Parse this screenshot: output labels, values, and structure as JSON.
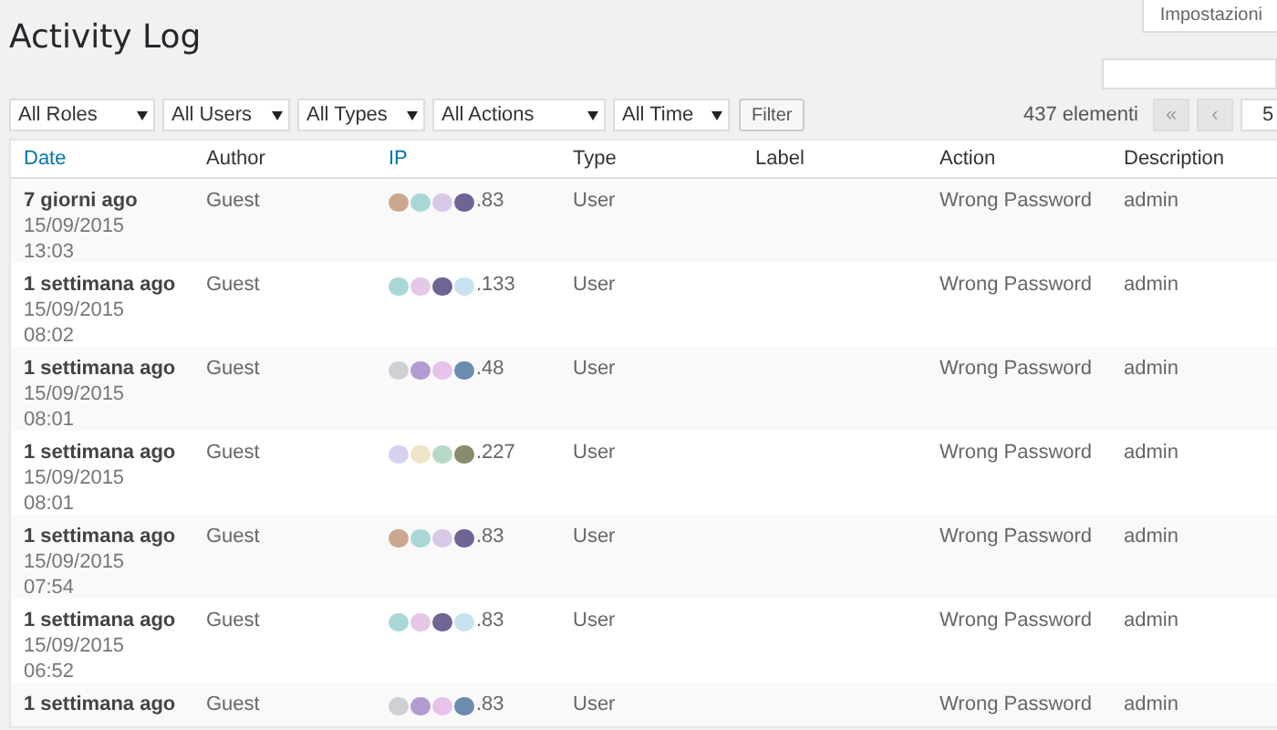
{
  "screen_options_tab": "Impostazioni",
  "title": "Activity Log",
  "filters": [
    {
      "label": "All Roles"
    },
    {
      "label": "All Users"
    },
    {
      "label": "All Types"
    },
    {
      "label": "All Actions"
    },
    {
      "label": "All Time"
    }
  ],
  "filter_button": "Filter",
  "pagination": {
    "count": "437 elementi",
    "first": "«",
    "prev": "‹",
    "page": "5"
  },
  "table": {
    "columns": [
      {
        "label": "Date",
        "sortable": true
      },
      {
        "label": "Author",
        "sortable": false
      },
      {
        "label": "IP",
        "sortable": true
      },
      {
        "label": "Type",
        "sortable": false
      },
      {
        "label": "Label",
        "sortable": false
      },
      {
        "label": "Action",
        "sortable": false
      },
      {
        "label": "Description",
        "sortable": false
      }
    ],
    "rows": [
      {
        "ago": "7 giorni ago",
        "date": "15/09/2015",
        "time": "13:03",
        "author": "Guest",
        "ip": ".83",
        "type": "User",
        "action": "Wrong Password",
        "description": "admin"
      },
      {
        "ago": "1 settimana ago",
        "date": "15/09/2015",
        "time": "08:02",
        "author": "Guest",
        "ip": ".133",
        "type": "User",
        "action": "Wrong Password",
        "description": "admin"
      },
      {
        "ago": "1 settimana ago",
        "date": "15/09/2015",
        "time": "08:01",
        "author": "Guest",
        "ip": ".48",
        "type": "User",
        "action": "Wrong Password",
        "description": "admin"
      },
      {
        "ago": "1 settimana ago",
        "date": "15/09/2015",
        "time": "08:01",
        "author": "Guest",
        "ip": ".227",
        "type": "User",
        "action": "Wrong Password",
        "description": "admin"
      },
      {
        "ago": "1 settimana ago",
        "date": "15/09/2015",
        "time": "07:54",
        "author": "Guest",
        "ip": ".83",
        "type": "User",
        "action": "Wrong Password",
        "description": "admin"
      },
      {
        "ago": "1 settimana ago",
        "date": "15/09/2015",
        "time": "06:52",
        "author": "Guest",
        "ip": ".83",
        "type": "User",
        "action": "Wrong Password",
        "description": "admin"
      },
      {
        "ago": "1 settimana ago",
        "author": "Guest",
        "ip": ".83",
        "type": "User",
        "action": "Wrong Password",
        "description": "admin"
      }
    ]
  }
}
